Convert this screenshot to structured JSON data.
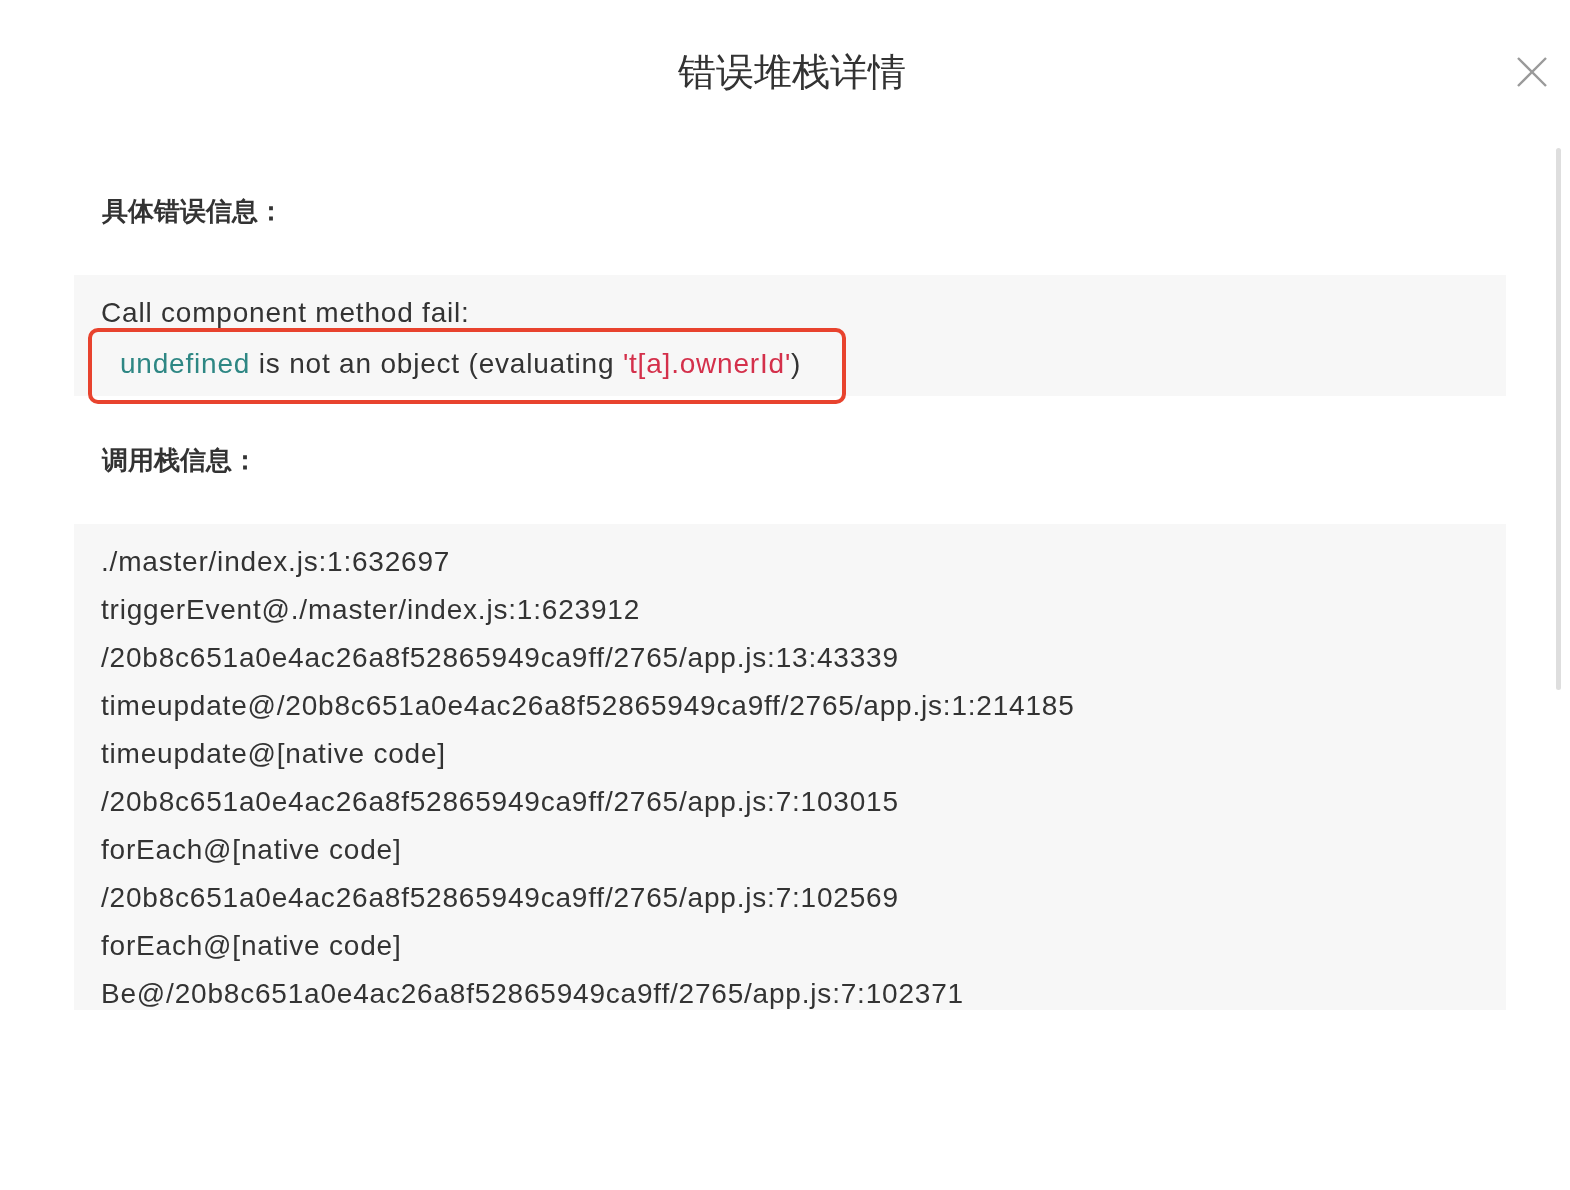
{
  "dialog": {
    "title": "错误堆栈详情"
  },
  "error_detail": {
    "heading": "具体错误信息：",
    "summary": "Call component method fail:",
    "message": {
      "highlighted": true,
      "segments": [
        {
          "kind": "value",
          "text": "undefined"
        },
        {
          "kind": "plain",
          "text": " is not an object (evaluating "
        },
        {
          "kind": "string",
          "text": "'t[a].ownerId'"
        },
        {
          "kind": "plain",
          "text": ")"
        }
      ]
    }
  },
  "call_stack": {
    "heading": "调用栈信息：",
    "lines": [
      "./master/index.js:1:632697",
      "triggerEvent@./master/index.js:1:623912",
      "/20b8c651a0e4ac26a8f52865949ca9ff/2765/app.js:13:43339",
      "timeupdate@/20b8c651a0e4ac26a8f52865949ca9ff/2765/app.js:1:214185",
      "timeupdate@[native code]",
      "/20b8c651a0e4ac26a8f52865949ca9ff/2765/app.js:7:103015",
      "forEach@[native code]",
      "/20b8c651a0e4ac26a8f52865949ca9ff/2765/app.js:7:102569",
      "forEach@[native code]",
      "Be@/20b8c651a0e4ac26a8f52865949ca9ff/2765/app.js:7:102371"
    ]
  }
}
